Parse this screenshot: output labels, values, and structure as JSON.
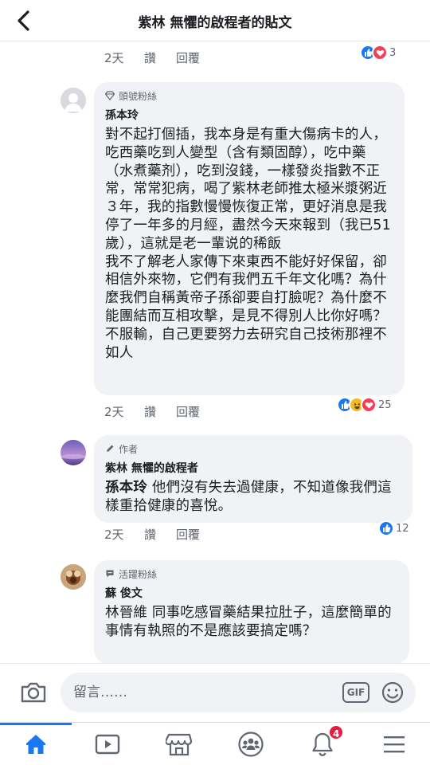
{
  "header": {
    "title": "紫林 無懼的啟程者的貼文",
    "back_icon": "chevron-left-icon"
  },
  "top_meta": {
    "time": "2天",
    "like_label": "讚",
    "reply_label": "回覆",
    "reaction_count": "3",
    "reactions": [
      "like",
      "love"
    ]
  },
  "comments": [
    {
      "badge_icon": "diamond-icon",
      "badge": "頭號粉絲",
      "author": "孫本玲",
      "paragraphs": [
        "對不起打個插，我本身是有重大傷病卡的人，吃西藥吃到人變型（含有類固醇），吃中藥（水煮藥剂），吃到沒錢，一樣發炎指數不正常，常常犯病，喝了紫林老師推太極米漿粥近３年，我的指數慢慢恢復正常，更好消息是我停了一年多的月經，盡然今天來報到（我已51歲），這就是老一輩说的稀飯",
        "我不了解老人家傳下來東西不能好好保留，卻相信外來物，它們有我們五千年文化嗎？為什麼我們自稱黃帝子孫卻要自打臉呢？為什麼不能團結而互相攻擊，是見不得別人比你好嗎？不服輸，自己更要努力去研究自己技術那裡不如人"
      ],
      "time": "2天",
      "like_label": "讚",
      "reply_label": "回覆",
      "reaction_count": "25",
      "reactions": [
        "like",
        "haha",
        "love"
      ]
    },
    {
      "badge_icon": "pencil-icon",
      "badge": "作者",
      "author": "紫林 無懼的啟程者",
      "mention": "孫本玲",
      "text": "  他們沒有失去過健康，不知道像我們這樣重拾健康的喜悅。",
      "time": "2天",
      "like_label": "讚",
      "reply_label": "回覆",
      "reaction_count": "12",
      "reactions": [
        "like"
      ]
    },
    {
      "badge_icon": "chat-bubble-icon",
      "badge": "活躍粉絲",
      "author": "蘇 俊文",
      "mention": "林晉維",
      "text": " 同事吃感冒藥結果拉肚子，這麼簡單的事情有執照的不是應該要搞定嗎？"
    }
  ],
  "composer": {
    "placeholder": "留言……",
    "gif_label": "GIF",
    "camera_icon": "camera-icon",
    "emoji_icon": "smiley-icon"
  },
  "tabbar": {
    "tabs": [
      "home-icon",
      "video-icon",
      "marketplace-icon",
      "groups-icon",
      "notifications-icon",
      "menu-icon"
    ],
    "active_tab": "home-icon",
    "notification_count": "4"
  },
  "colors": {
    "accent": "#1877f2",
    "bubble": "#f0f2f5",
    "badge_red": "#e41e3f"
  }
}
